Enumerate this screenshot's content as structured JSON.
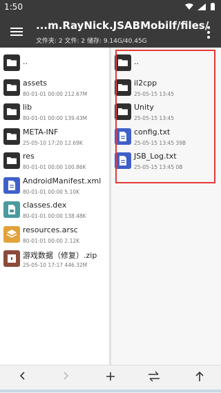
{
  "statusbar": {
    "time": "1:50"
  },
  "appbar": {
    "title": "...m.RayNick.JSABMobilf/files/",
    "subtitle": "文件夹: 2  文件: 2  储存: 9.14G/40.45G"
  },
  "left_pane": {
    "items": [
      {
        "name": "..",
        "meta": "",
        "type": "folder"
      },
      {
        "name": "assets",
        "meta": "80-01-01 00:00  212.67M",
        "type": "folder"
      },
      {
        "name": "lib",
        "meta": "80-01-01 00:00  139.43M",
        "type": "folder"
      },
      {
        "name": "META-INF",
        "meta": "25-05-10 17:20  12.69K",
        "type": "folder"
      },
      {
        "name": "res",
        "meta": "80-01-01 00:00  100.86K",
        "type": "folder"
      },
      {
        "name": "AndroidManifest.xml",
        "meta": "80-01-01 00:00  5.10K",
        "type": "doc"
      },
      {
        "name": "classes.dex",
        "meta": "80-01-01 00:00  138.48K",
        "type": "dex"
      },
      {
        "name": "resources.arsc",
        "meta": "80-01-01 00:00  2.12K",
        "type": "arsc"
      },
      {
        "name": "游戏数据（修复）.zip",
        "meta": "25-05-10 17:17  446.32M",
        "type": "zip"
      }
    ]
  },
  "right_pane": {
    "items": [
      {
        "name": "..",
        "meta": "",
        "type": "folder"
      },
      {
        "name": "il2cpp",
        "meta": "25-05-15 13:45",
        "type": "folder"
      },
      {
        "name": "Unity",
        "meta": "25-05-15 13:45",
        "type": "folder"
      },
      {
        "name": "config.txt",
        "meta": "25-05-15 13:45  39B",
        "type": "doc"
      },
      {
        "name": "JSB_Log.txt",
        "meta": "25-05-15 13:45  0B",
        "type": "doc"
      }
    ]
  },
  "bottom_bar": {
    "buttons": [
      "back-arrow-icon",
      "forward-arrow-icon",
      "plus-icon",
      "swap-icon",
      "up-arrow-icon"
    ]
  },
  "colors": {
    "appbar": "#3a3a3a",
    "selection_border": "#e53935",
    "doc": "#3f5fc9"
  }
}
